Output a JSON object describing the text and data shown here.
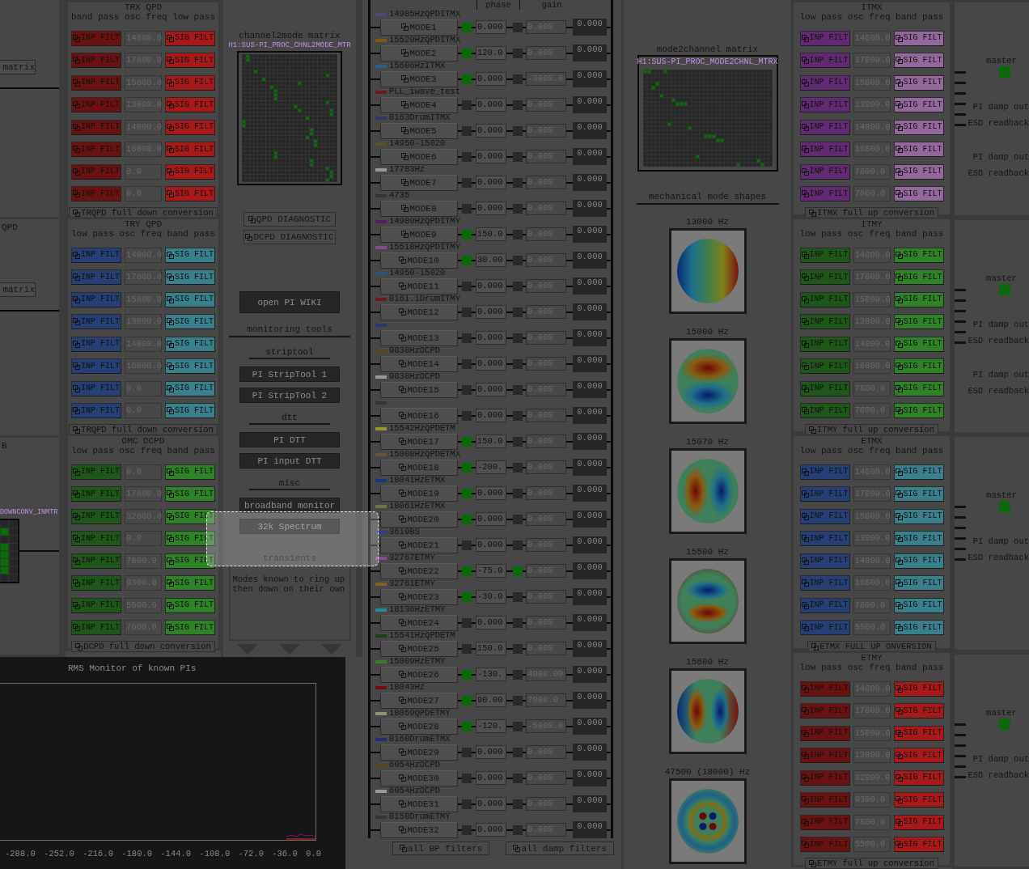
{
  "left_edge": {
    "panels": [
      {
        "button": "matrix"
      },
      {
        "title": "QPD",
        "button": "matrix"
      },
      {
        "title": "B",
        "matrix_name": "DOWNCONV_INMTR"
      }
    ]
  },
  "filter_banks_left": [
    {
      "title": "TRX QPD",
      "headers": [
        "band pass",
        "osc freq",
        "low pass"
      ],
      "color": "#6a1212",
      "sig": {
        "color": "#a81a1a"
      },
      "footer": "TRQPD full down conversion",
      "rows": [
        {
          "input": "INP FILT",
          "freq": "14800.0",
          "signal": "SIG FILT"
        },
        {
          "input": "INP FILT",
          "freq": "17800.0",
          "signal": "SIG FILT"
        },
        {
          "input": "INP FILT",
          "freq": "15800.0",
          "signal": "SIG FILT"
        },
        {
          "input": "INP FILT",
          "freq": "13800.0",
          "signal": "SIG FILT"
        },
        {
          "input": "INP FILT",
          "freq": "14800.0",
          "signal": "SIG FILT"
        },
        {
          "input": "INP FILT",
          "freq": "16800.0",
          "signal": "SIG FILT"
        },
        {
          "input": "INP FILT",
          "freq": "0.0",
          "signal": "SIG FILT"
        },
        {
          "input": "INP FILT",
          "freq": "0.0",
          "signal": "SIG FILT"
        }
      ]
    },
    {
      "title": "TRY QPD",
      "headers": [
        "low pass",
        "osc freq",
        "band pass"
      ],
      "color": "#263f74",
      "sig": {
        "color": "#3a7f8c"
      },
      "footer": "TRQPD full down conversion",
      "rows": [
        {
          "input": "INP FILT",
          "freq": "14800.0",
          "signal": "SIG FILT"
        },
        {
          "input": "INP FILT",
          "freq": "17800.0",
          "signal": "SIG FILT"
        },
        {
          "input": "INP FILT",
          "freq": "15800.0",
          "signal": "SIG FILT"
        },
        {
          "input": "INP FILT",
          "freq": "13800.0",
          "signal": "SIG FILT"
        },
        {
          "input": "INP FILT",
          "freq": "14800.0",
          "signal": "SIG FILT"
        },
        {
          "input": "INP FILT",
          "freq": "16800.0",
          "signal": "SIG FILT"
        },
        {
          "input": "INP FILT",
          "freq": "0.0",
          "signal": "SIG FILT"
        },
        {
          "input": "INP FILT",
          "freq": "0.0",
          "signal": "SIG FILT"
        }
      ]
    },
    {
      "title": "OMC DCPD",
      "headers": [
        "low pass",
        "osc freq",
        "band pass"
      ],
      "color": "#1f561a",
      "sig": {
        "color": "#2f8228"
      },
      "footer": "DCPD full down conversion",
      "rows": [
        {
          "input": "INP FILT",
          "freq": "0.0",
          "signal": "SIG FILT"
        },
        {
          "input": "INP FILT",
          "freq": "17800.0",
          "signal": "SIG FILT"
        },
        {
          "input": "INP FILT",
          "freq": "32800.0",
          "signal": "SIG FILT"
        },
        {
          "input": "INP FILT",
          "freq": "0.0",
          "signal": "SIG FILT"
        },
        {
          "input": "INP FILT",
          "freq": "7800.0",
          "signal": "SIG FILT"
        },
        {
          "input": "INP FILT",
          "freq": "9300.0",
          "signal": "SIG FILT"
        },
        {
          "input": "INP FILT",
          "freq": "5500.0",
          "signal": "SIG FILT"
        },
        {
          "input": "INP FILT",
          "freq": "7600.0",
          "signal": "SIG FILT"
        }
      ]
    }
  ],
  "center": {
    "matrix_title": "channel2mode matrix",
    "matrix_name": "H1:SUS-PI_PROC_CHNL2MODE_MTR",
    "diagnostics": [
      "QPD DIAGNOSTIC",
      "DCPD DIAGNOSTIC"
    ],
    "wiki": "open PI WIKI",
    "tools_title": "monitoring tools",
    "groups": [
      {
        "title": "striptool",
        "buttons": [
          "PI StripTool 1",
          "PI StripTool 2"
        ]
      },
      {
        "title": "dtt",
        "buttons": [
          "PI DTT",
          "PI input DTT"
        ]
      },
      {
        "title": "misc",
        "buttons": [
          "broadband monitor",
          "32k Spectrum"
        ]
      }
    ],
    "transients_title": "transients",
    "note": "Modes known to ring up then down on their own"
  },
  "modes": {
    "headers": [
      "phase",
      "gain"
    ],
    "items": [
      {
        "label": "14985HzQPDITMX",
        "color": "#4a4a78",
        "name": "MODE1",
        "phase_on": true,
        "phase": "0.000",
        "gain_on": false,
        "gain": "0.000",
        "output": "0.000"
      },
      {
        "label": "15520HzQPDITMX",
        "color": "#84560e",
        "name": "MODE2",
        "phase_on": true,
        "phase": "120.0",
        "gain_on": false,
        "gain": "0.000",
        "output": "0.000"
      },
      {
        "label": "15606HzITMX",
        "color": "#2a5e8c",
        "name": "MODE3",
        "phase_on": true,
        "phase": "0.000",
        "gain_on": false,
        "gain": "-3000.0",
        "output": "0.000"
      },
      {
        "label": "PLL_iwave_test",
        "color": "#6e1a1a",
        "name": "MODE4",
        "phase_on": false,
        "phase": "0.000",
        "gain_on": false,
        "gain": "0.000",
        "output": "0.000"
      },
      {
        "label": "8163DrumITMX",
        "color": "#34346e",
        "name": "MODE5",
        "phase_on": false,
        "phase": "0.000",
        "gain_on": false,
        "gain": "0.000",
        "output": "0.000"
      },
      {
        "label": "14950-15020",
        "color": "#56522a",
        "name": "MODE6",
        "phase_on": false,
        "phase": "0.000",
        "gain_on": false,
        "gain": "0.000",
        "output": "0.000"
      },
      {
        "label": "17783Hz",
        "color": "#9a9a9a",
        "name": "MODE7",
        "phase_on": false,
        "phase": "0.000",
        "gain_on": false,
        "gain": "0.000",
        "output": "0.000"
      },
      {
        "label": "4735",
        "color": "#343434",
        "name": "MODE8",
        "phase_on": false,
        "phase": "0.000",
        "gain_on": false,
        "gain": "0.000",
        "output": "0.000"
      },
      {
        "label": "14980HzQPDITMY",
        "color": "#561a66",
        "name": "MODE9",
        "phase_on": true,
        "phase": "150.0",
        "gain_on": false,
        "gain": "0.000",
        "output": "0.000"
      },
      {
        "label": "15518HzQPDITMY",
        "color": "#844a92",
        "name": "MODE10",
        "phase_on": true,
        "phase": "30.00",
        "gain_on": false,
        "gain": "0.000",
        "output": "0.000"
      },
      {
        "label": "14950-15020",
        "color": "#2a567e",
        "name": "MODE11",
        "phase_on": false,
        "phase": "0.000",
        "gain_on": false,
        "gain": "0.000",
        "output": "0.000"
      },
      {
        "label": "8161.1DrumITMY",
        "color": "#6e1a1a",
        "name": "MODE12",
        "phase_on": false,
        "phase": "0.000",
        "gain_on": false,
        "gain": "0.000",
        "output": "0.000"
      },
      {
        "color": "#2a3672",
        "name": "MODE13",
        "phase_on": false,
        "phase": "0.000",
        "gain_on": false,
        "gain": "0.000",
        "output": "0.000"
      },
      {
        "label": "9830HzDCPD",
        "color": "#564626",
        "name": "MODE14",
        "phase_on": false,
        "phase": "0.000",
        "gain_on": false,
        "gain": "0.000",
        "output": "0.000"
      },
      {
        "label": "9830HzDCPD",
        "color": "#9a9a9a",
        "name": "MODE15",
        "phase_on": false,
        "phase": "0.000",
        "gain_on": false,
        "gain": "0.000",
        "output": "0.000"
      },
      {
        "color": "#343434",
        "name": "MODE16",
        "phase_on": false,
        "phase": "0.000",
        "gain_on": false,
        "gain": "0.000",
        "output": "0.000"
      },
      {
        "label": "15542HzQPDETM",
        "color": "#96962e",
        "name": "MODE17",
        "phase_on": true,
        "phase": "150.0",
        "gain_on": false,
        "gain": "0.000",
        "output": "0.000"
      },
      {
        "label": "15008HzQPDETMX",
        "color": "#645638",
        "name": "MODE18",
        "phase_on": true,
        "phase": "-200.",
        "gain_on": false,
        "gain": "0.000",
        "output": "0.000"
      },
      {
        "label": "18041HzETMX",
        "color": "#1a3682",
        "name": "MODE19",
        "phase_on": true,
        "phase": "0.000",
        "gain_on": false,
        "gain": "0.000",
        "output": "0.000"
      },
      {
        "label": "18061HzETMX",
        "color": "#727246",
        "name": "MODE20",
        "phase_on": true,
        "phase": "0.000",
        "gain_on": false,
        "gain": "0.000",
        "output": "0.000"
      },
      {
        "label": "3619BS",
        "color": "#383896",
        "name": "MODE21",
        "phase_on": false,
        "phase": "0.000",
        "gain_on": false,
        "gain": "0.000",
        "output": "0.000"
      },
      {
        "label": "32767ETMY",
        "color": "#844a92",
        "name": "MODE22",
        "phase_on": true,
        "phase": "-75.0",
        "gain_on": true,
        "gain": "0.000",
        "output": "0.000"
      },
      {
        "label": "32761ETMY",
        "color": "#84621e",
        "name": "MODE23",
        "phase_on": true,
        "phase": "-30.0",
        "gain_on": false,
        "gain": "0.000",
        "output": "0.000"
      },
      {
        "label": "18136HzETMY",
        "color": "#2a829e",
        "name": "MODE24",
        "phase_on": false,
        "phase": "0.000",
        "gain_on": false,
        "gain": "0.000",
        "output": "0.000"
      },
      {
        "label": "15541HzQPDETM",
        "color": "#1a4212",
        "name": "MODE25",
        "phase_on": false,
        "phase": "150.0",
        "gain_on": false,
        "gain": "0.000",
        "output": "0.000"
      },
      {
        "label": "15009HzETMY",
        "color": "#367e2a",
        "name": "MODE26",
        "phase_on": true,
        "phase": "-130.",
        "gain_on": false,
        "gain": "4000.00",
        "output": "0.000"
      },
      {
        "label": "18043Hz",
        "color": "#6e1010",
        "name": "MODE27",
        "phase_on": true,
        "phase": "90.00",
        "gain_on": false,
        "gain": "7000.0",
        "output": "0.000"
      },
      {
        "label": "18059QPDETMY",
        "color": "#929270",
        "name": "MODE28",
        "phase_on": true,
        "phase": "-120.",
        "gain_on": false,
        "gain": "-5000.0",
        "output": "0.000"
      },
      {
        "label": "8160DrumETMX",
        "color": "#2a2a72",
        "name": "MODE29",
        "phase_on": false,
        "phase": "0.000",
        "gain_on": false,
        "gain": "0.000",
        "output": "0.000"
      },
      {
        "label": "6054HzDCPD",
        "color": "#564626",
        "name": "MODE30",
        "phase_on": false,
        "phase": "0.000",
        "gain_on": false,
        "gain": "0.000",
        "output": "0.000"
      },
      {
        "label": "6054HzDCPD",
        "color": "#9a9a9a",
        "name": "MODE31",
        "phase_on": false,
        "phase": "0.000",
        "gain_on": false,
        "gain": "0.000",
        "output": "0.000"
      },
      {
        "label": "8158DrumETMY",
        "color": "#343434",
        "name": "MODE32",
        "phase_on": false,
        "phase": "0.000",
        "gain_on": false,
        "gain": "0.000",
        "output": "0.000"
      }
    ],
    "buttons": [
      "all BP filters",
      "all damp filters"
    ]
  },
  "mode2channel": {
    "title": "mode2channel matrix",
    "matrix_name": "H1:SUS-PI_PROC_MODE2CHNL_MTRX"
  },
  "mode_shapes": {
    "title": "mechanical mode shapes",
    "items": [
      {
        "label": "13000 Hz",
        "kind": "tilt"
      },
      {
        "label": "15000 Hz",
        "kind": "vertical"
      },
      {
        "label": "15070 Hz",
        "kind": "horizontal"
      },
      {
        "label": "15500 Hz",
        "kind": "vertical-inverse"
      },
      {
        "label": "15600 Hz",
        "kind": "horizontal-edge"
      },
      {
        "label": "47500 (18000) Hz",
        "kind": "ring"
      }
    ]
  },
  "filter_banks_right": [
    {
      "title": "ITMX",
      "headers": [
        "low pass",
        "osc freq",
        "band pass"
      ],
      "color": "#622a72",
      "sig": {
        "color": "#94689c"
      },
      "footer": "ITMX full up conversion",
      "rows": [
        {
          "input": "INP FILT",
          "freq": "14800.0",
          "signal": "SIG FILT"
        },
        {
          "input": "INP FILT",
          "freq": "17800.0",
          "signal": "SIG FILT"
        },
        {
          "input": "INP FILT",
          "freq": "15800.0",
          "signal": "SIG FILT"
        },
        {
          "input": "INP FILT",
          "freq": "13800.0",
          "signal": "SIG FILT"
        },
        {
          "input": "INP FILT",
          "freq": "14800.0",
          "signal": "SIG FILT"
        },
        {
          "input": "INP FILT",
          "freq": "16800.0",
          "signal": "SIG FILT"
        },
        {
          "input": "INP FILT",
          "freq": "7800.0",
          "signal": "SIG FILT"
        },
        {
          "input": "INP FILT",
          "freq": "7600.0",
          "signal": "SIG FILT"
        }
      ]
    },
    {
      "title": "ITMY",
      "headers": [
        "low pass",
        "osc freq",
        "band pass"
      ],
      "color": "#1f561a",
      "sig": {
        "color": "#2f8228"
      },
      "footer": "ITMY full up conversion",
      "rows": [
        {
          "input": "INP FILT",
          "freq": "14800.0",
          "signal": "SIG FILT"
        },
        {
          "input": "INP FILT",
          "freq": "17800.0",
          "signal": "SIG FILT"
        },
        {
          "input": "INP FILT",
          "freq": "15800.0",
          "signal": "SIG FILT"
        },
        {
          "input": "INP FILT",
          "freq": "13800.0",
          "signal": "SIG FILT"
        },
        {
          "input": "INP FILT",
          "freq": "14800.0",
          "signal": "SIG FILT"
        },
        {
          "input": "INP FILT",
          "freq": "16800.0",
          "signal": "SIG FILT"
        },
        {
          "input": "INP FILT",
          "freq": "7800.0",
          "signal": "SIG FILT"
        },
        {
          "input": "INP FILT",
          "freq": "7600.0",
          "signal": "SIG FILT"
        }
      ]
    },
    {
      "title": "ETMX",
      "headers": [
        "low pass",
        "osc freq",
        "band pass"
      ],
      "color": "#263f74",
      "sig": {
        "color": "#3a7f8c"
      },
      "footer": "ETMX FULL UP ONVERSION",
      "rows": [
        {
          "input": "INP FILT",
          "freq": "14800.0",
          "signal": "SIG FILT"
        },
        {
          "input": "INP FILT",
          "freq": "17800.0",
          "signal": "SIG FILT"
        },
        {
          "input": "INP FILT",
          "freq": "15800.0",
          "signal": "SIG FILT"
        },
        {
          "input": "INP FILT",
          "freq": "13800.0",
          "signal": "SIG FILT"
        },
        {
          "input": "INP FILT",
          "freq": "14800.0",
          "signal": "SIG FILT"
        },
        {
          "input": "INP FILT",
          "freq": "16800.0",
          "signal": "SIG FILT"
        },
        {
          "input": "INP FILT",
          "freq": "7800.0",
          "signal": "SIG FILT"
        },
        {
          "input": "INP FILT",
          "freq": "5500.0",
          "signal": "SIG FILT"
        }
      ]
    },
    {
      "title": "ETMY",
      "headers": [
        "low pass",
        "osc freq",
        "band pass"
      ],
      "color": "#6a1212",
      "sig": {
        "color": "#a81a1a"
      },
      "footer": "ETMY full up conversion",
      "rows": [
        {
          "input": "INP FILT",
          "freq": "14800.0",
          "signal": "SIG FILT"
        },
        {
          "input": "INP FILT",
          "freq": "17800.0",
          "signal": "SIG FILT"
        },
        {
          "input": "INP FILT",
          "freq": "15800.0",
          "signal": "SIG FILT"
        },
        {
          "input": "INP FILT",
          "freq": "13800.0",
          "signal": "SIG FILT"
        },
        {
          "input": "INP FILT",
          "freq": "32800.0",
          "signal": "SIG FILT"
        },
        {
          "input": "INP FILT",
          "freq": "9300.0",
          "signal": "SIG FILT"
        },
        {
          "input": "INP FILT",
          "freq": "7800.0",
          "signal": "SIG FILT"
        },
        {
          "input": "INP FILT",
          "freq": "5500.0",
          "signal": "SIG FILT"
        }
      ]
    }
  ],
  "outputs": [
    {
      "label": "master",
      "on": true,
      "lines": [
        "PI damp out",
        "ESD readback",
        "PI damp out",
        "ESD readback"
      ]
    },
    {
      "label": "master",
      "on": true,
      "lines": [
        "PI damp out",
        "ESD readback",
        "PI damp out",
        "ESD readback"
      ]
    },
    {
      "label": "master",
      "on": true,
      "lines": [
        "PI damp out",
        "ESD readback"
      ]
    },
    {
      "label": "master",
      "on": true,
      "lines": [
        "PI damp out",
        "ESD readback"
      ]
    }
  ],
  "rms_monitor": {
    "title": "RMS Monitor of known PIs",
    "tick_labels": [
      "-288.0",
      "-252.0",
      "-216.0",
      "-180.0",
      "-144.0",
      "-108.0",
      "-72.0",
      "-36.0",
      "0.0"
    ]
  }
}
